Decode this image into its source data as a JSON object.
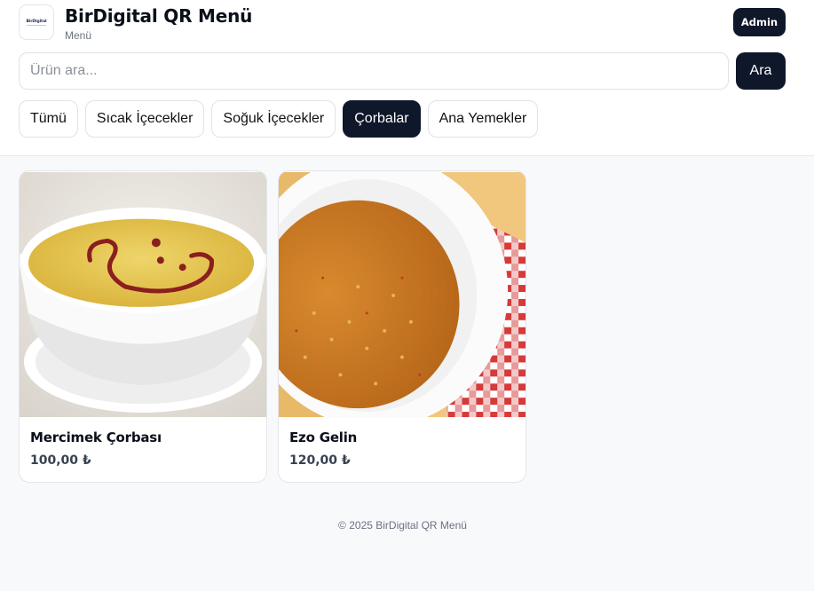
{
  "header": {
    "logo_text": "BirDigital",
    "title": "BirDigital QR Menü",
    "subtitle": "Menü",
    "admin_label": "Admin"
  },
  "search": {
    "placeholder": "Ürün ara...",
    "value": "",
    "button_label": "Ara"
  },
  "categories": [
    {
      "label": "Tümü",
      "active": false
    },
    {
      "label": "Sıcak İçecekler",
      "active": false
    },
    {
      "label": "Soğuk İçecekler",
      "active": false
    },
    {
      "label": "Çorbalar",
      "active": true
    },
    {
      "label": "Ana Yemekler",
      "active": false
    }
  ],
  "products": [
    {
      "name": "Mercimek Çorbası",
      "price": "100,00 ₺",
      "image_icon": "lentil-soup-photo"
    },
    {
      "name": "Ezo Gelin",
      "price": "120,00 ₺",
      "image_icon": "ezogelin-soup-photo"
    }
  ],
  "footer": {
    "text": "© 2025 BirDigital QR Menü"
  },
  "colors": {
    "primary": "#0f172a",
    "background": "#f8f9fb",
    "border": "#dfe2e7",
    "muted_text": "#6b7280"
  }
}
